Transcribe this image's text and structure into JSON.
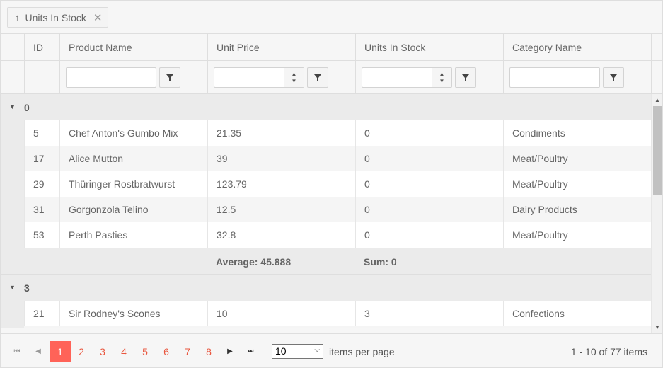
{
  "grouping": {
    "chip_label": "Units In Stock",
    "sort_arrow": "↑",
    "remove_icon": "✕"
  },
  "columns": [
    {
      "label": "ID"
    },
    {
      "label": "Product Name"
    },
    {
      "label": "Unit Price"
    },
    {
      "label": "Units In Stock"
    },
    {
      "label": "Category Name"
    }
  ],
  "groups": [
    {
      "value": "0",
      "rows": [
        {
          "id": "5",
          "name": "Chef Anton's Gumbo Mix",
          "price": "21.35",
          "stock": "0",
          "category": "Condiments"
        },
        {
          "id": "17",
          "name": "Alice Mutton",
          "price": "39",
          "stock": "0",
          "category": "Meat/Poultry"
        },
        {
          "id": "29",
          "name": "Thüringer Rostbratwurst",
          "price": "123.79",
          "stock": "0",
          "category": "Meat/Poultry"
        },
        {
          "id": "31",
          "name": "Gorgonzola Telino",
          "price": "12.5",
          "stock": "0",
          "category": "Dairy Products"
        },
        {
          "id": "53",
          "name": "Perth Pasties",
          "price": "32.8",
          "stock": "0",
          "category": "Meat/Poultry"
        }
      ],
      "footer": {
        "price_aggregate": "Average: 45.888",
        "stock_aggregate": "Sum: 0"
      }
    },
    {
      "value": "3",
      "rows": [
        {
          "id": "21",
          "name": "Sir Rodney's Scones",
          "price": "10",
          "stock": "3",
          "category": "Confections"
        }
      ]
    }
  ],
  "pager": {
    "pages": [
      "1",
      "2",
      "3",
      "4",
      "5",
      "6",
      "7",
      "8"
    ],
    "active_page": "1",
    "page_size": "10",
    "items_per_page_label": "items per page",
    "info": "1 - 10 of 77 items"
  },
  "colors": {
    "accent": "#ff6358",
    "link": "#e9573f"
  }
}
